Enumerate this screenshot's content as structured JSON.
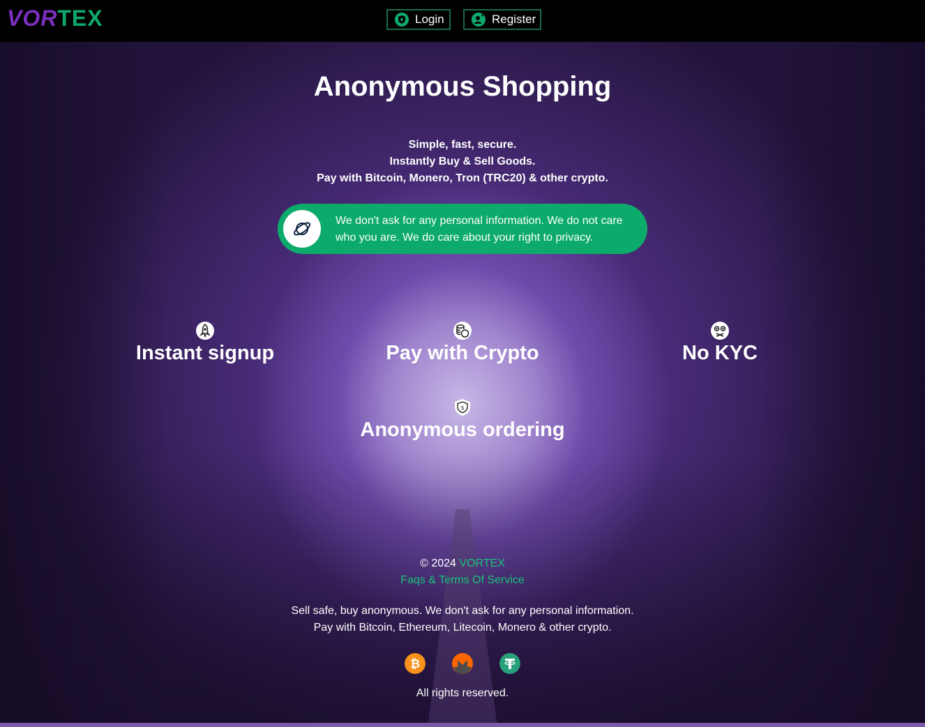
{
  "header": {
    "logo_part1": "VOR",
    "logo_part2": "TEX",
    "login_label": "Login",
    "register_label": "Register"
  },
  "hero": {
    "title": "Anonymous Shopping",
    "taglines": [
      "Simple, fast, secure.",
      "Instantly Buy & Sell Goods.",
      "Pay with Bitcoin, Monero, Tron (TRC20) & other crypto."
    ],
    "privacy_notice": "We don't ask for any personal information. We do not care who you are. We do care about your right to privacy."
  },
  "features": [
    {
      "label": "Instant signup",
      "icon": "rocket-icon"
    },
    {
      "label": "Pay with Crypto",
      "icon": "coins-icon"
    },
    {
      "label": "No KYC",
      "icon": "anonymous-mask-icon"
    },
    {
      "label": "Anonymous ordering",
      "icon": "shield-dollar-icon"
    }
  ],
  "footer": {
    "copyright_prefix": "© 2024",
    "brand": "VORTEX",
    "faq_link": "Faqs & Terms Of Service",
    "line1": "Sell safe, buy anonymous. We don't ask for any personal information.",
    "line2": "Pay with Bitcoin, Ethereum, Litecoin, Monero & other crypto.",
    "coins": [
      "bitcoin-icon",
      "monero-icon",
      "tether-icon"
    ],
    "rights": "All rights reserved."
  },
  "colors": {
    "accent_green": "#0dab6b",
    "brand_purple": "#7b2fbf",
    "header_bg": "#000000"
  }
}
